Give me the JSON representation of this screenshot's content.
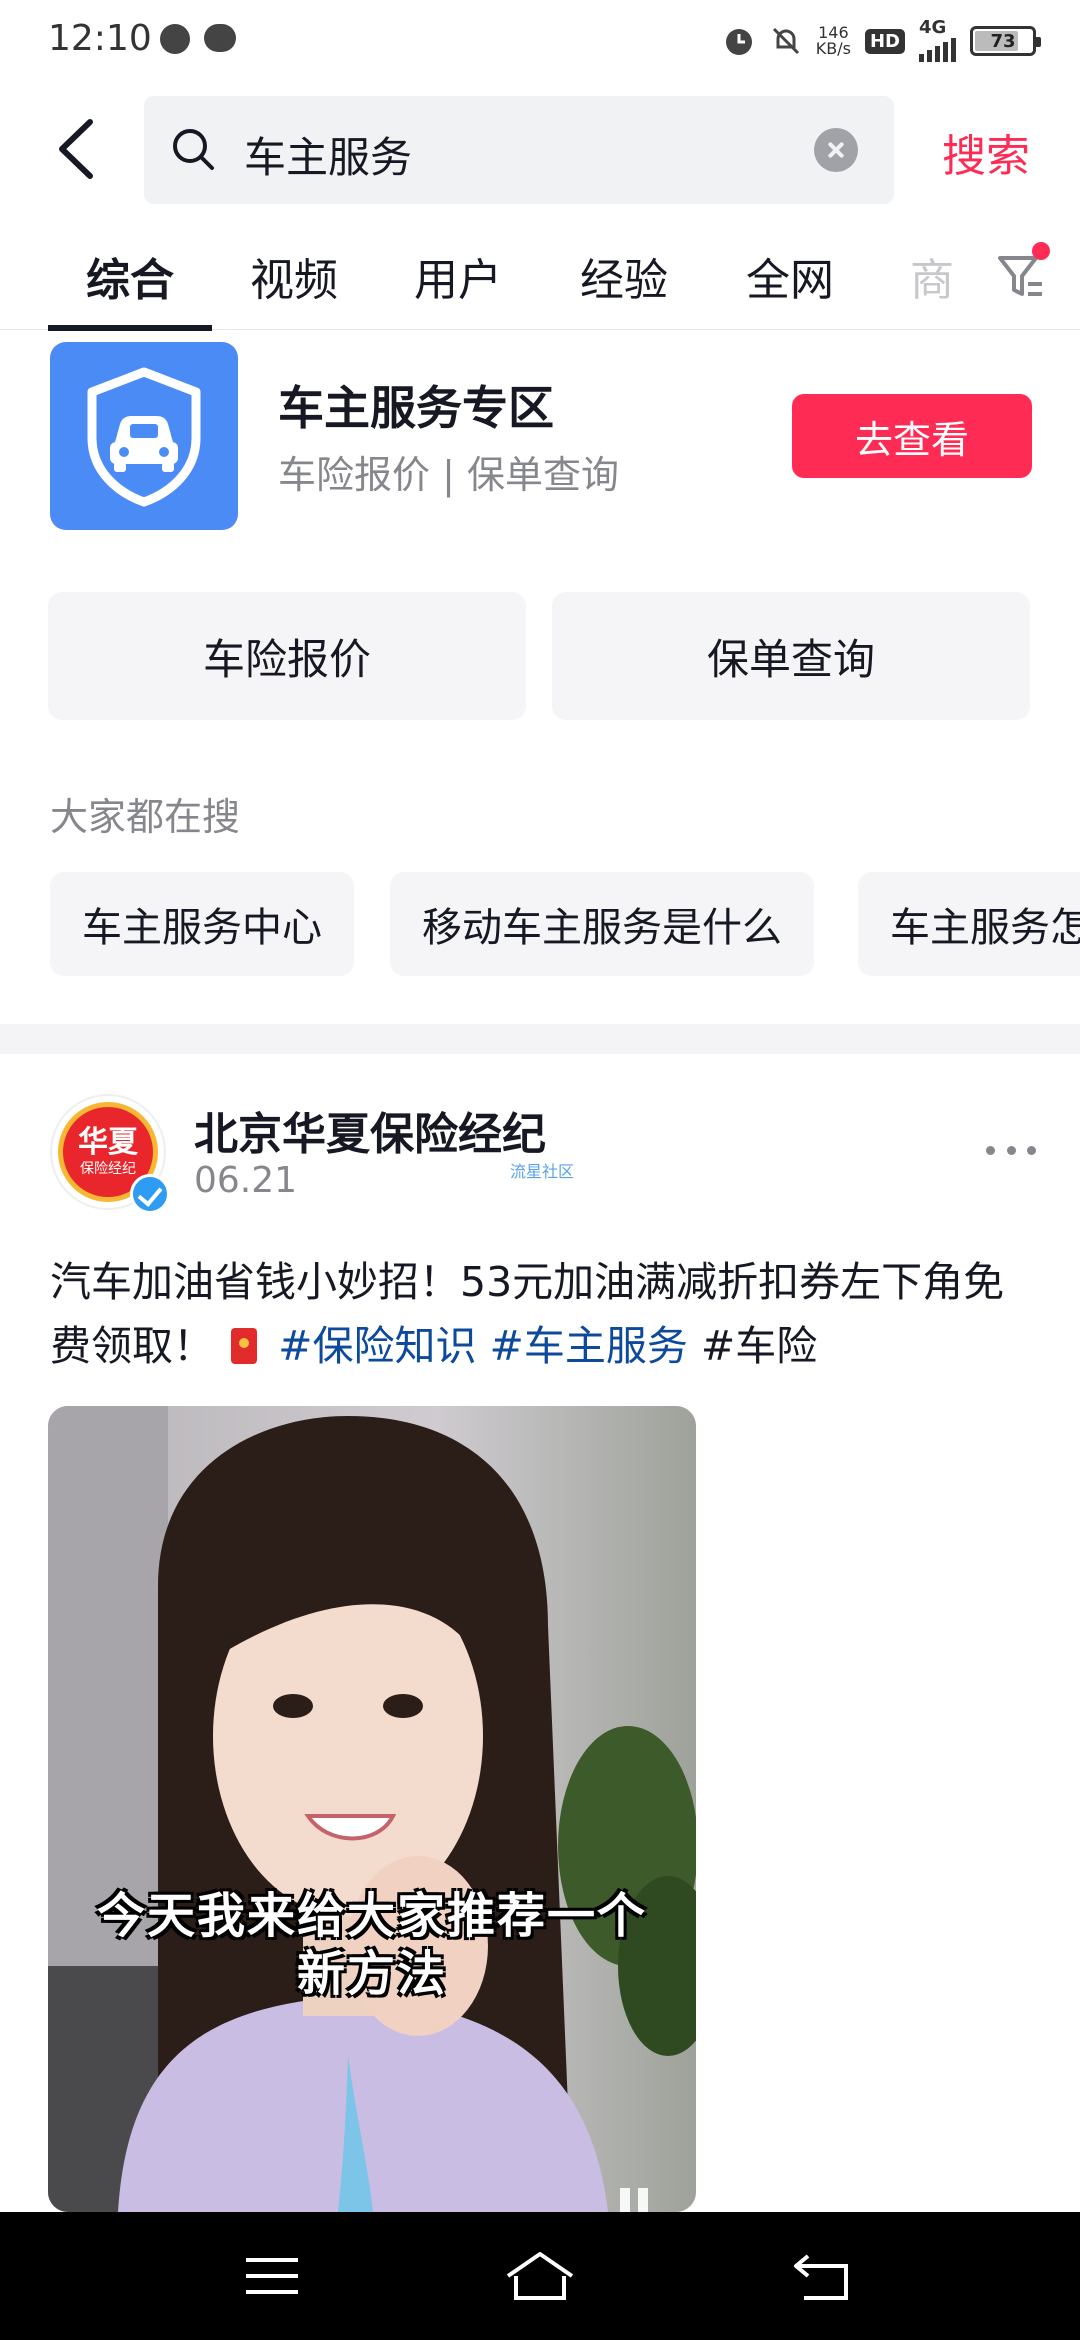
{
  "status_bar": {
    "time": "12:10",
    "net_speed_value": "146",
    "net_speed_unit": "KB/s",
    "hd_label": "HD",
    "network_label": "4G",
    "battery_level": "73"
  },
  "search": {
    "query": "车主服务",
    "submit_label": "搜索"
  },
  "tabs": [
    {
      "label": "综合",
      "active": true
    },
    {
      "label": "视频"
    },
    {
      "label": "用户"
    },
    {
      "label": "经验"
    },
    {
      "label": "全网"
    },
    {
      "label": "商"
    }
  ],
  "service_card": {
    "title": "车主服务专区",
    "subtitle": "车险报价 | 保单查询",
    "action_label": "去查看",
    "quick_actions": [
      "车险报价",
      "保单查询"
    ]
  },
  "trending": {
    "title": "大家都在搜",
    "items": [
      "车主服务中心",
      "移动车主服务是什么",
      "车主服务怎"
    ]
  },
  "post": {
    "author": "北京华夏保险经纪",
    "date": "06.21",
    "avatar_text_main": "华夏",
    "avatar_text_sub": "保险经纪",
    "watermark": "流星社区",
    "text_main": "汽车加油省钱小妙招！53元加油满减折扣券左下角免费领取！",
    "hashtags": [
      "#保险知识",
      "#车主服务"
    ],
    "tag_plain": "#车险",
    "video_subtitle_line1": "今天我来给大家推荐一个",
    "video_subtitle_line2": "新方法"
  },
  "colors": {
    "accent": "#fe2c55",
    "service_logo_bg": "#4b8bf5",
    "hashtag": "#0d4a9c",
    "verified": "#2f9cf3"
  },
  "icons": [
    "back-arrow-icon",
    "search-icon",
    "clear-icon",
    "filter-icon",
    "shield-car-icon",
    "verified-icon",
    "more-icon",
    "red-envelope-icon",
    "pause-icon",
    "menu-icon",
    "home-icon",
    "return-icon"
  ]
}
